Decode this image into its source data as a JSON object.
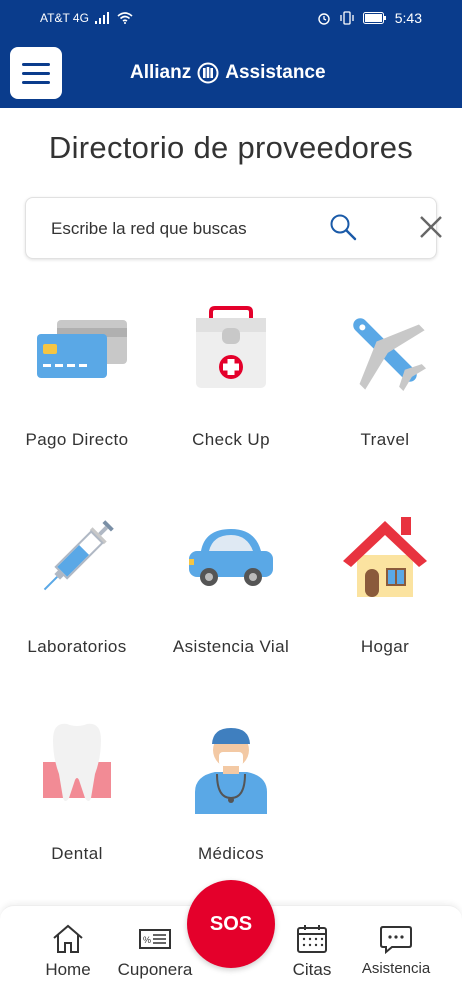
{
  "status_bar": {
    "carrier": "AT&T 4G",
    "time": "5:43"
  },
  "header": {
    "brand": "Allianz",
    "brand_suffix": "Assistance",
    "brand_color": "#0a3c8c"
  },
  "page": {
    "title": "Directorio de proveedores"
  },
  "search": {
    "placeholder": "Escribe la red que buscas",
    "value": ""
  },
  "categories": [
    {
      "label": "Pago Directo",
      "icon": "credit-cards-icon"
    },
    {
      "label": "Check Up",
      "icon": "first-aid-kit-icon"
    },
    {
      "label": "Travel",
      "icon": "airplane-icon"
    },
    {
      "label": "Laboratorios",
      "icon": "syringe-icon"
    },
    {
      "label": "Asistencia Vial",
      "icon": "car-icon"
    },
    {
      "label": "Hogar",
      "icon": "house-icon"
    },
    {
      "label": "Dental",
      "icon": "tooth-icon"
    },
    {
      "label": "Médicos",
      "icon": "doctor-icon"
    }
  ],
  "bottom_nav": {
    "items": [
      {
        "label": "Home",
        "icon": "home-icon"
      },
      {
        "label": "Cuponera",
        "icon": "coupon-icon"
      },
      {
        "label": "Citas",
        "icon": "calendar-icon"
      },
      {
        "label": "Asistencia",
        "icon": "chat-icon"
      }
    ],
    "sos_label": "SOS",
    "sos_color": "#e4002b"
  }
}
